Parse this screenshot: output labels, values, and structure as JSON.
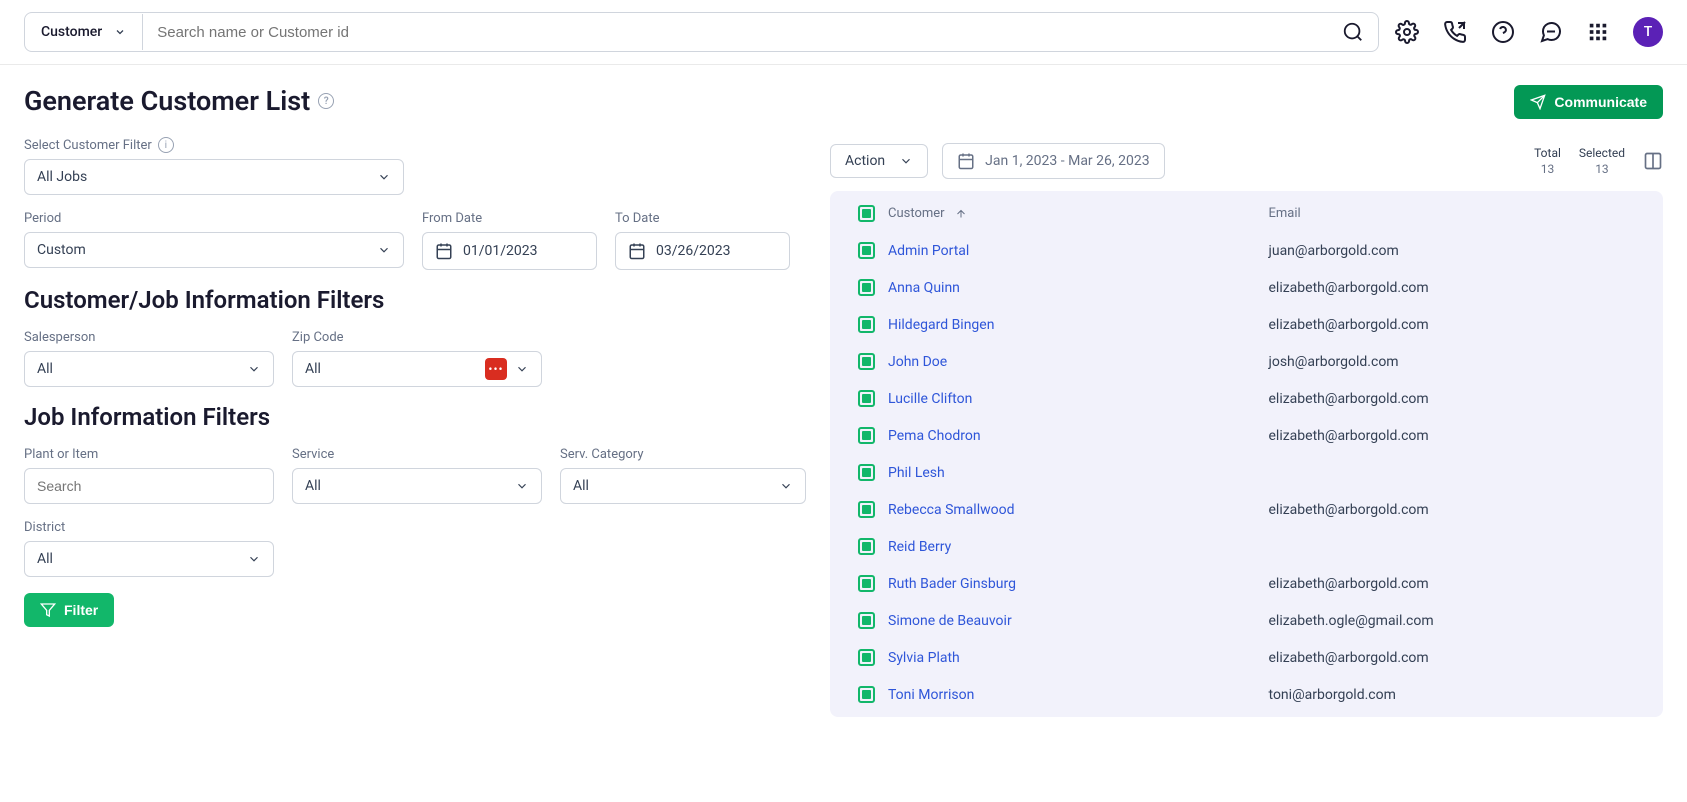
{
  "topbar": {
    "filter_label": "Customer",
    "search_placeholder": "Search name or Customer id",
    "avatar_letter": "T"
  },
  "page": {
    "title": "Generate Customer List",
    "communicate_label": "Communicate"
  },
  "filters": {
    "customer_filter_label": "Select Customer Filter",
    "customer_filter_value": "All Jobs",
    "period_label": "Period",
    "period_value": "Custom",
    "from_date_label": "From Date",
    "from_date_value": "01/01/2023",
    "to_date_label": "To Date",
    "to_date_value": "03/26/2023",
    "cj_heading": "Customer/Job Information Filters",
    "salesperson_label": "Salesperson",
    "salesperson_value": "All",
    "zip_label": "Zip Code",
    "zip_value": "All",
    "job_heading": "Job Information Filters",
    "plant_label": "Plant or Item",
    "plant_placeholder": "Search",
    "service_label": "Service",
    "service_value": "All",
    "serv_cat_label": "Serv. Category",
    "serv_cat_value": "All",
    "district_label": "District",
    "district_value": "All",
    "filter_button": "Filter"
  },
  "results": {
    "action_label": "Action",
    "date_range": "Jan 1, 2023 - Mar 26, 2023",
    "total_label": "Total",
    "total_value": "13",
    "selected_label": "Selected",
    "selected_value": "13",
    "col_customer": "Customer",
    "col_email": "Email",
    "rows": [
      {
        "name": "Admin Portal",
        "email": "juan@arborgold.com"
      },
      {
        "name": "Anna Quinn",
        "email": "elizabeth@arborgold.com"
      },
      {
        "name": "Hildegard Bingen",
        "email": "elizabeth@arborgold.com"
      },
      {
        "name": "John Doe",
        "email": "josh@arborgold.com"
      },
      {
        "name": "Lucille Clifton",
        "email": "elizabeth@arborgold.com"
      },
      {
        "name": "Pema Chodron",
        "email": "elizabeth@arborgold.com"
      },
      {
        "name": "Phil Lesh",
        "email": ""
      },
      {
        "name": "Rebecca Smallwood",
        "email": "elizabeth@arborgold.com"
      },
      {
        "name": "Reid Berry",
        "email": ""
      },
      {
        "name": "Ruth Bader Ginsburg",
        "email": "elizabeth@arborgold.com"
      },
      {
        "name": "Simone de Beauvoir",
        "email": "elizabeth.ogle@gmail.com"
      },
      {
        "name": "Sylvia Plath",
        "email": "elizabeth@arborgold.com"
      },
      {
        "name": "Toni Morrison",
        "email": "toni@arborgold.com"
      }
    ]
  }
}
